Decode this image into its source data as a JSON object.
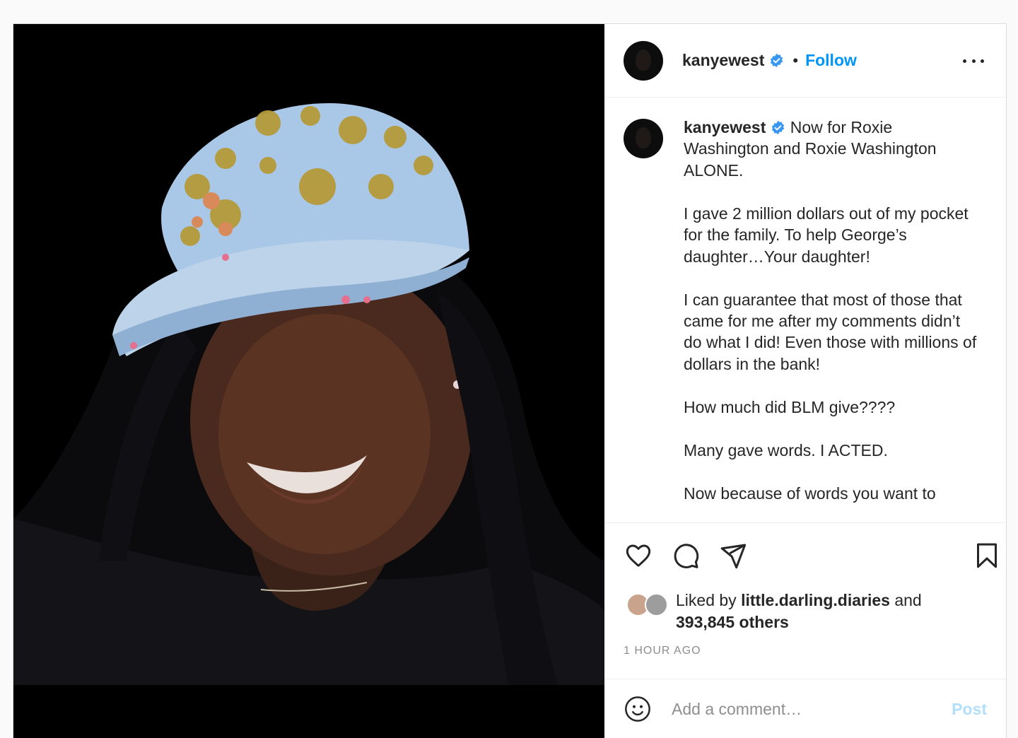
{
  "colors": {
    "accent": "#0095f6",
    "text": "#262626",
    "secondary_text": "#8e8e8e",
    "post_disabled": "#b2dffc",
    "verified_badge": "#3897f0"
  },
  "header": {
    "username": "kanyewest",
    "verified_icon": "verified-badge-icon",
    "separator": "•",
    "follow_label": "Follow",
    "more_icon": "more-options-icon"
  },
  "caption": {
    "username": "kanyewest",
    "first_line": "Now for Roxie Washington and Roxie Washington ALONE.",
    "paragraphs": [
      "I gave 2 million dollars out of my pocket for the family. To help George’s daughter…Your daughter!",
      "I can guarantee that most of those that came for me after my comments didn’t do what I did! Even those with millions of dollars in the bank!",
      "How much did BLM give????",
      "Many gave words. I ACTED.",
      "Now because of words you want to"
    ]
  },
  "actions": {
    "like_icon": "heart-icon",
    "comment_icon": "comment-bubble-icon",
    "share_icon": "paper-plane-icon",
    "save_icon": "bookmark-icon"
  },
  "likes": {
    "prefix": "Liked by ",
    "user": "little.darling.diaries",
    "connector": " and",
    "count_text": "393,845 others"
  },
  "timestamp": "1 HOUR AGO",
  "comment": {
    "emoji_icon": "smiley-icon",
    "placeholder": "Add a comment…",
    "post_label": "Post"
  }
}
